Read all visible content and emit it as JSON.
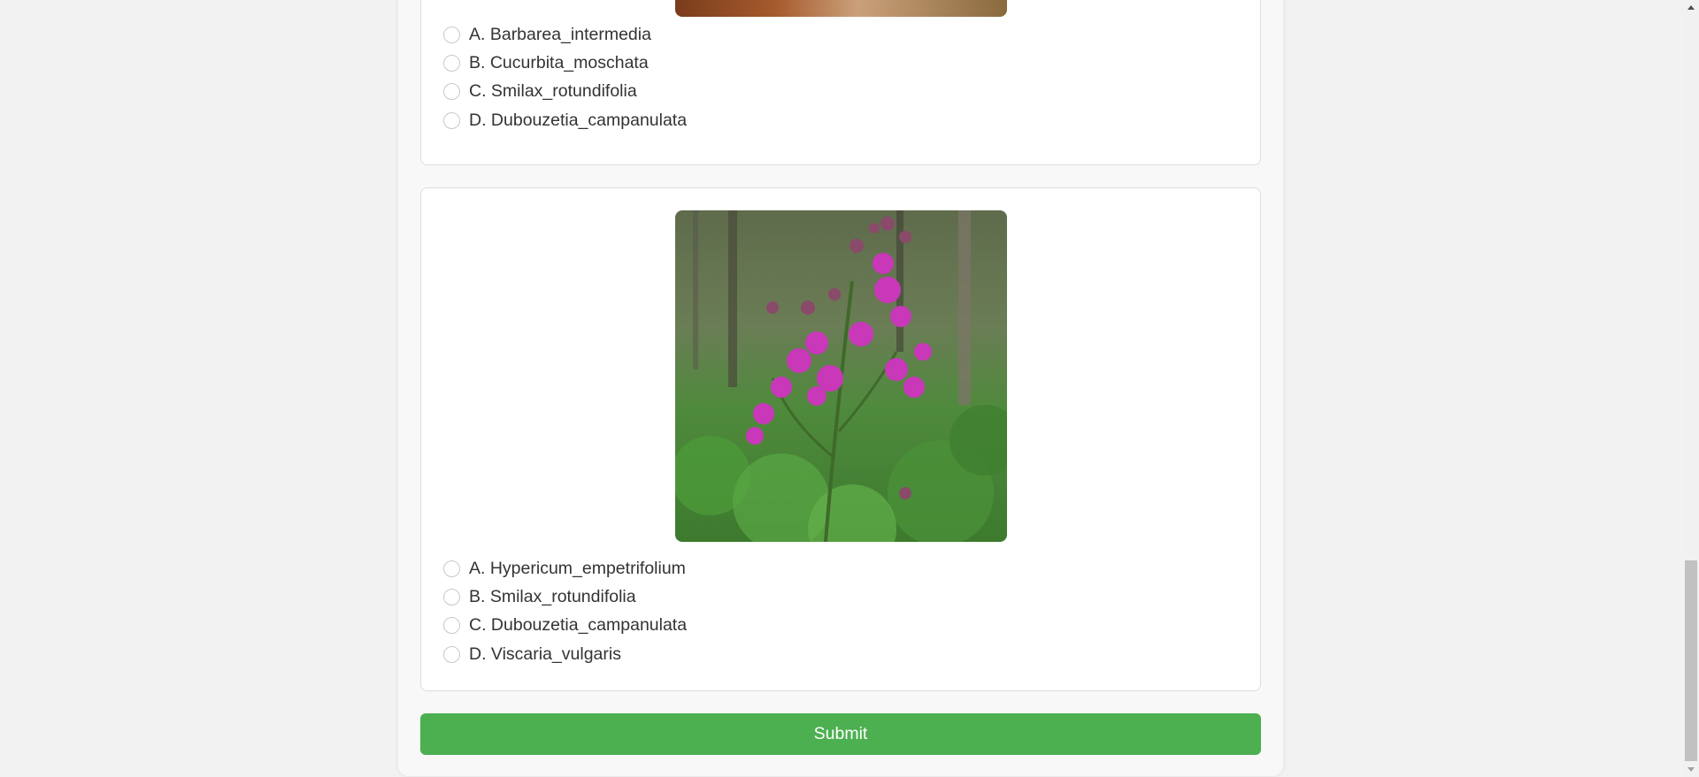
{
  "questions": [
    {
      "options": [
        {
          "label": "A. Barbarea_intermedia"
        },
        {
          "label": "B. Cucurbita_moschata"
        },
        {
          "label": "C. Smilax_rotundifolia"
        },
        {
          "label": "D. Dubouzetia_campanulata"
        }
      ]
    },
    {
      "options": [
        {
          "label": "A. Hypericum_empetrifolium"
        },
        {
          "label": "B. Smilax_rotundifolia"
        },
        {
          "label": "C. Dubouzetia_campanulata"
        },
        {
          "label": "D. Viscaria_vulgaris"
        }
      ]
    }
  ],
  "submit": {
    "label": "Submit"
  },
  "colors": {
    "accent": "#4caf50",
    "background": "#f2f2f2",
    "card": "#ffffff"
  }
}
